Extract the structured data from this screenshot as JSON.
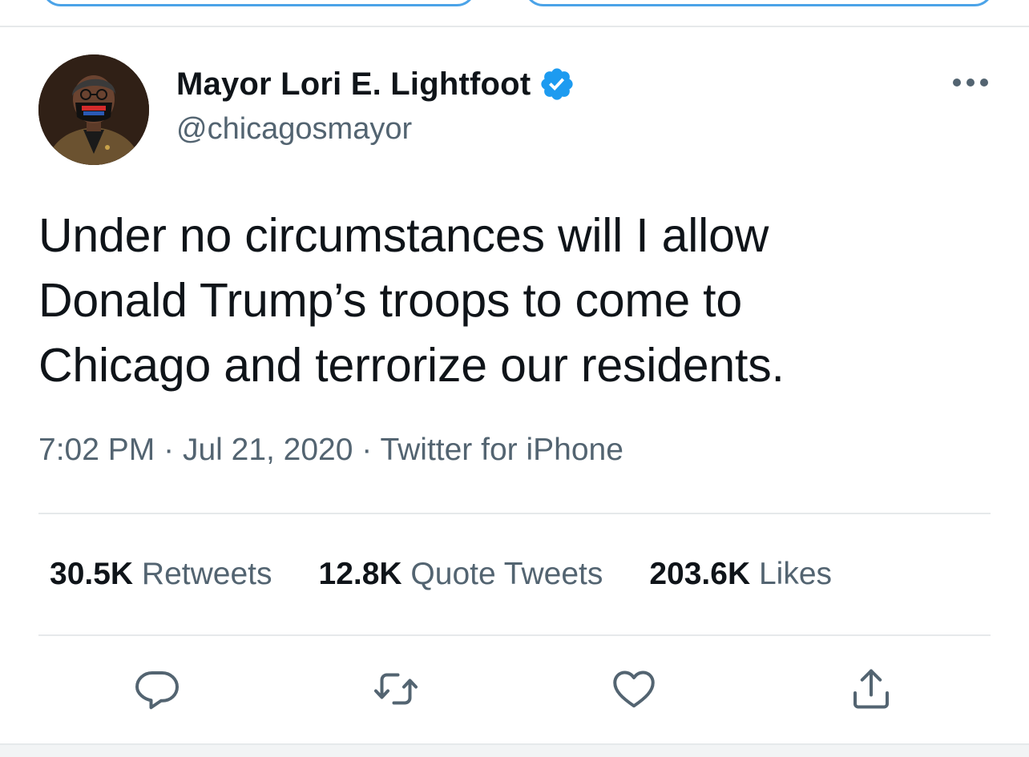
{
  "tweet": {
    "author": {
      "display_name": "Mayor Lori E. Lightfoot",
      "handle": "@chicagosmayor",
      "verified": true,
      "avatar_mask_text": "VOTE"
    },
    "text_lines": [
      "Under no circumstances will I allow",
      "Donald Trump’s troops to come to",
      "Chicago and terrorize our residents."
    ],
    "meta": {
      "time": "7:02 PM",
      "separator": "·",
      "date": "Jul 21, 2020",
      "source": "Twitter for iPhone"
    },
    "stats": [
      {
        "count": "30.5K",
        "label": "Retweets"
      },
      {
        "count": "12.8K",
        "label": "Quote Tweets"
      },
      {
        "count": "203.6K",
        "label": "Likes"
      }
    ],
    "actions": [
      {
        "name": "reply",
        "icon": "reply-icon"
      },
      {
        "name": "retweet",
        "icon": "retweet-icon"
      },
      {
        "name": "like",
        "icon": "heart-icon"
      },
      {
        "name": "share",
        "icon": "share-icon"
      }
    ]
  },
  "colors": {
    "text_primary": "#0f1419",
    "text_secondary": "#536471",
    "accent_blue": "#1d9bf0",
    "divider": "#e6e9eb"
  }
}
